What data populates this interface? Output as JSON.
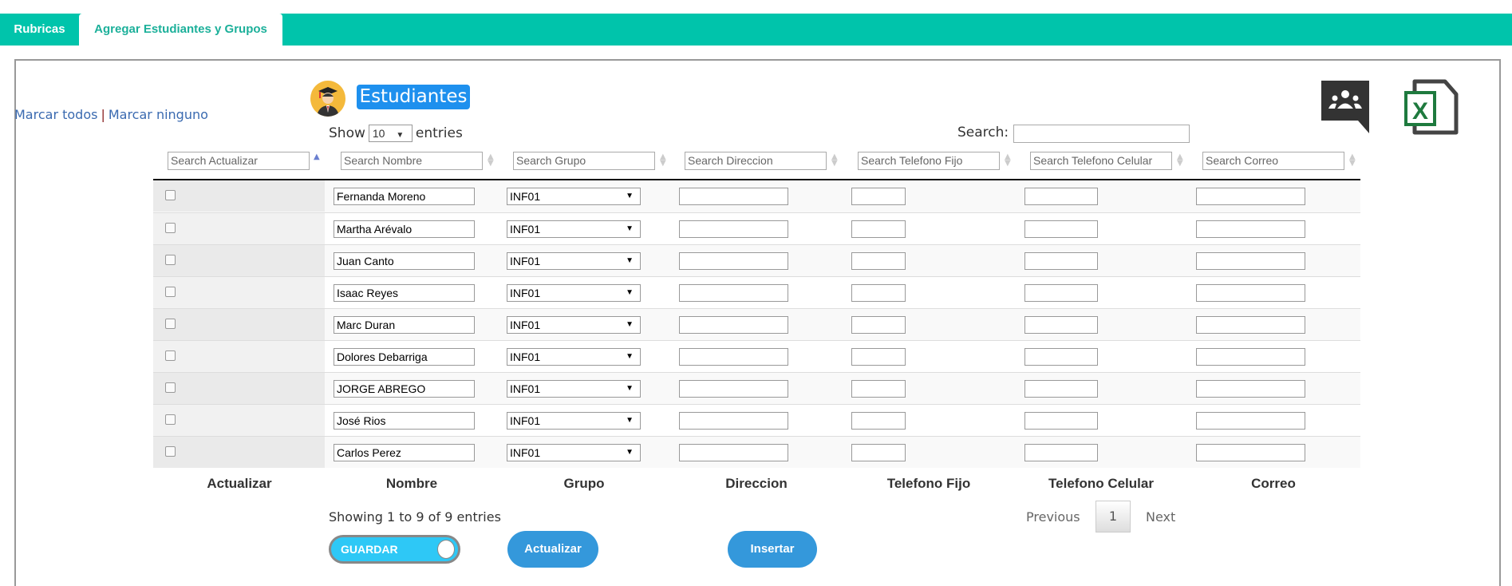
{
  "tabs": [
    {
      "label": "Rubricas"
    },
    {
      "label": "Agregar Estudiantes y Grupos",
      "active": true
    }
  ],
  "marcar": {
    "todos": "Marcar todos",
    "sep": "|",
    "ninguno": "Marcar ninguno"
  },
  "title": "Estudiantes",
  "length": {
    "show": "Show",
    "value": "10",
    "entries": "entries"
  },
  "search": {
    "label": "Search:",
    "value": ""
  },
  "filters": [
    "Search Actualizar",
    "Search Nombre",
    "Search Grupo",
    "Search Direccion",
    "Search Telefono Fijo",
    "Search Telefono Celular",
    "Search Correo"
  ],
  "columns": [
    "Actualizar",
    "Nombre",
    "Grupo",
    "Direccion",
    "Telefono Fijo",
    "Telefono Celular",
    "Correo"
  ],
  "rows": [
    {
      "nombre": "Fernanda Moreno",
      "grupo": "INF01"
    },
    {
      "nombre": "Martha Arévalo",
      "grupo": "INF01"
    },
    {
      "nombre": "Juan Canto",
      "grupo": "INF01"
    },
    {
      "nombre": "Isaac Reyes",
      "grupo": "INF01"
    },
    {
      "nombre": "Marc Duran",
      "grupo": "INF01"
    },
    {
      "nombre": "Dolores Debarriga",
      "grupo": "INF01"
    },
    {
      "nombre": "JORGE ABREGO",
      "grupo": "INF01"
    },
    {
      "nombre": "José Rios",
      "grupo": "INF01"
    },
    {
      "nombre": "Carlos Perez",
      "grupo": "INF01"
    }
  ],
  "info": "Showing 1 to 9 of 9 entries",
  "pagination": {
    "previous": "Previous",
    "page": "1",
    "next": "Next"
  },
  "buttons": {
    "guardar": "GUARDAR",
    "actualizar": "Actualizar",
    "insertar": "Insertar"
  },
  "colors": {
    "tabbar": "#00c4ab",
    "accent": "#3498db",
    "badge": "#1e90ee",
    "link": "#3a6ab0"
  }
}
